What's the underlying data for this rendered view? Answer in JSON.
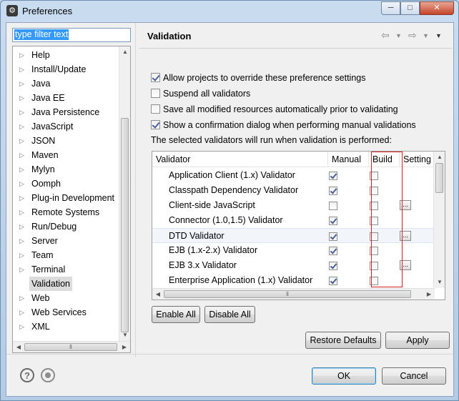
{
  "window": {
    "title": "Preferences",
    "app_icon": "gear-app-icon",
    "controls": {
      "minimize": "─",
      "maximize": "□",
      "close": "✕"
    }
  },
  "filter": {
    "value": "type filter text"
  },
  "tree": {
    "items": [
      {
        "label": "Help",
        "expandable": true,
        "selected": false
      },
      {
        "label": "Install/Update",
        "expandable": true,
        "selected": false
      },
      {
        "label": "Java",
        "expandable": true,
        "selected": false
      },
      {
        "label": "Java EE",
        "expandable": true,
        "selected": false
      },
      {
        "label": "Java Persistence",
        "expandable": true,
        "selected": false
      },
      {
        "label": "JavaScript",
        "expandable": true,
        "selected": false
      },
      {
        "label": "JSON",
        "expandable": true,
        "selected": false
      },
      {
        "label": "Maven",
        "expandable": true,
        "selected": false
      },
      {
        "label": "Mylyn",
        "expandable": true,
        "selected": false
      },
      {
        "label": "Oomph",
        "expandable": true,
        "selected": false
      },
      {
        "label": "Plug-in Development",
        "expandable": true,
        "selected": false
      },
      {
        "label": "Remote Systems",
        "expandable": true,
        "selected": false
      },
      {
        "label": "Run/Debug",
        "expandable": true,
        "selected": false
      },
      {
        "label": "Server",
        "expandable": true,
        "selected": false
      },
      {
        "label": "Team",
        "expandable": true,
        "selected": false
      },
      {
        "label": "Terminal",
        "expandable": true,
        "selected": false
      },
      {
        "label": "Validation",
        "expandable": false,
        "selected": true
      },
      {
        "label": "Web",
        "expandable": true,
        "selected": false
      },
      {
        "label": "Web Services",
        "expandable": true,
        "selected": false
      },
      {
        "label": "XML",
        "expandable": true,
        "selected": false
      }
    ]
  },
  "page": {
    "title": "Validation",
    "nav_icons": [
      "back-arrow-icon",
      "back-menu-icon",
      "forward-arrow-icon",
      "forward-menu-icon",
      "view-menu-icon"
    ],
    "options": [
      {
        "label": "Allow projects to override these preference settings",
        "checked": true
      },
      {
        "label": "Suspend all validators",
        "checked": false
      },
      {
        "label": "Save all modified resources automatically prior to validating",
        "checked": false
      },
      {
        "label": "Show a confirmation dialog when performing manual validations",
        "checked": true
      }
    ],
    "info_text": "The selected validators will run when validation is performed:"
  },
  "table": {
    "columns": [
      "Validator",
      "Manual",
      "Build",
      "Setting"
    ],
    "rows": [
      {
        "name": "Application Client (1.x) Validator",
        "manual": true,
        "build": false,
        "settings": false
      },
      {
        "name": "Classpath Dependency Validator",
        "manual": true,
        "build": false,
        "settings": false
      },
      {
        "name": "Client-side JavaScript",
        "manual": false,
        "build": false,
        "settings": true
      },
      {
        "name": "Connector (1.0,1.5) Validator",
        "manual": true,
        "build": false,
        "settings": false
      },
      {
        "name": "DTD Validator",
        "manual": true,
        "build": false,
        "settings": true
      },
      {
        "name": "EJB (1.x-2.x) Validator",
        "manual": true,
        "build": false,
        "settings": false
      },
      {
        "name": "EJB 3.x Validator",
        "manual": true,
        "build": false,
        "settings": true
      },
      {
        "name": "Enterprise Application (1.x) Validator",
        "manual": true,
        "build": false,
        "settings": false
      }
    ],
    "settings_button_label": "...",
    "selected_row": 4,
    "highlight_color": "#d62020"
  },
  "buttons": {
    "enable_all": "Enable All",
    "disable_all": "Disable All",
    "restore_defaults": "Restore Defaults",
    "apply": "Apply",
    "ok": "OK",
    "cancel": "Cancel"
  },
  "footer_icons": [
    "help-icon",
    "record-icon"
  ]
}
